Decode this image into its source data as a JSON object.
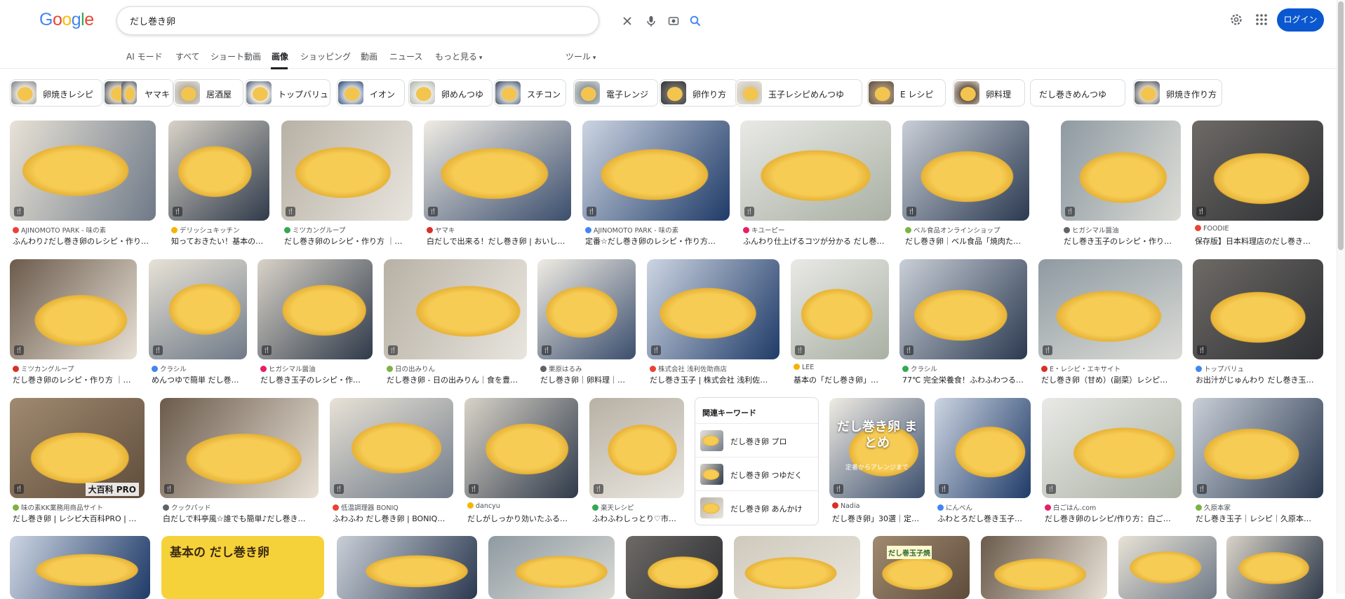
{
  "header": {
    "logo": "Google",
    "search_value": "だし巻き卵",
    "login_label": "ログイン"
  },
  "tabs": [
    {
      "label": "AI モード"
    },
    {
      "label": "すべて"
    },
    {
      "label": "ショート動画"
    },
    {
      "label": "画像",
      "selected": true
    },
    {
      "label": "ショッピング"
    },
    {
      "label": "動画"
    },
    {
      "label": "ニュース"
    },
    {
      "label": "もっと見る"
    },
    {
      "label": "ツール"
    }
  ],
  "chips": [
    "卵焼きレシピ",
    "ヤマキ",
    "居酒屋",
    "トップバリュ",
    "イオン",
    "卵めんつゆ",
    "スチコン",
    "電子レンジ",
    "卵作り方",
    "玉子レシピめんつゆ",
    "E レシピ",
    "卵料理",
    "だし巻きめんつゆ",
    "卵焼き作り方"
  ],
  "rows": [
    [
      {
        "source": "AJINOMOTO PARK - 味の素",
        "title": "ふんわり♪だし巻き卵のレシピ・作り…"
      },
      {
        "source": "デリッシュキッチン",
        "title": "知っておきたい！基本の…"
      },
      {
        "source": "ミツカングループ",
        "title": "だし巻き卵のレシピ・作り方 ｜…"
      },
      {
        "source": "ヤマキ",
        "title": "白だしで出来る！だし巻き卵 | おいし…"
      },
      {
        "source": "AJINOMOTO PARK - 味の素",
        "title": "定番☆だし巻き卵のレシピ・作り方…"
      },
      {
        "source": "キユーピー",
        "title": "ふんわり仕上げるコツが分かる だし巻…"
      },
      {
        "source": "ベル食品オンラインショップ",
        "title": "だし巻き卵｜ベル食品「焼肉たれ」…"
      },
      {
        "source": "ヒガシマル醤油",
        "title": "だし巻き玉子のレシピ・作り…"
      },
      {
        "source": "FOODIE",
        "title": "保存版】日本料理店のだし巻き…"
      }
    ],
    [
      {
        "source": "ミツカングループ",
        "title": "だし巻き卵のレシピ・作り方 ｜…"
      },
      {
        "source": "クラシル",
        "title": "めんつゆで簡単 だし巻…"
      },
      {
        "source": "ヒガシマル醤油",
        "title": "だし巻き玉子のレシピ・作…"
      },
      {
        "source": "日の出みりん",
        "title": "だし巻き卵 - 日の出みりん｜食を豊…"
      },
      {
        "source": "栗原はるみ",
        "title": "だし巻き卵｜卵料理｜…"
      },
      {
        "source": "株式会社 浅利佐助商店",
        "title": "だし巻き玉子 | 株式会社 浅利佐…"
      },
      {
        "source": "LEE",
        "title": "基本の「だし巻き卵」…"
      },
      {
        "source": "クラシル",
        "title": "77℃ 完全栄養食！ふわふわつる…"
      },
      {
        "source": "E・レシピ・エキサイト",
        "title": "だし巻き卵（甘め）(副菜）レシピ…"
      },
      {
        "source": "トップバリュ",
        "title": "お出汁がじゅんわり だし巻き玉…"
      }
    ],
    [
      {
        "source": "味の素KK業務用商品サイト",
        "title": "だし巻き卵 | レシピ大百科PRO | 味…"
      },
      {
        "source": "クックパッド",
        "title": "白だしで料亭風☆誰でも簡単♪だし巻き…"
      },
      {
        "source": "低温調理器 BONIQ",
        "title": "ふわふわ だし巻き卵 | BONIQ…"
      },
      {
        "source": "dancyu",
        "title": "だしがしっかり効いたふる…"
      },
      {
        "source": "楽天レシピ",
        "title": "ふわふわしっとり♡市…"
      },
      {
        "source": "Nadia",
        "title": "だし巻き卵」30選｜定…"
      },
      {
        "source": "にんべん",
        "title": "ふわとろだし巻き玉子…"
      },
      {
        "source": "白ごはん.com",
        "title": "だし巻き卵のレシピ/作り方：白ご…"
      },
      {
        "source": "久原本家",
        "title": "だし巻き玉子｜レシピ｜久原本…"
      }
    ]
  ],
  "overlay_text": {
    "pro": "大百科 PRO",
    "matome": "だし巻き卵 まとめ",
    "matome_sub": "定番からアレンジまで",
    "kihon": "基本の だし巻き卵",
    "pack": "だし巻玉子焼"
  },
  "related": {
    "heading": "関連キーワード",
    "items": [
      "だし巻き卵 プロ",
      "だし巻き卵 つゆだく",
      "だし巻き卵 あんかけ"
    ]
  },
  "colors": {
    "accent": "#0b57d0",
    "egg": "#f2c14e"
  }
}
